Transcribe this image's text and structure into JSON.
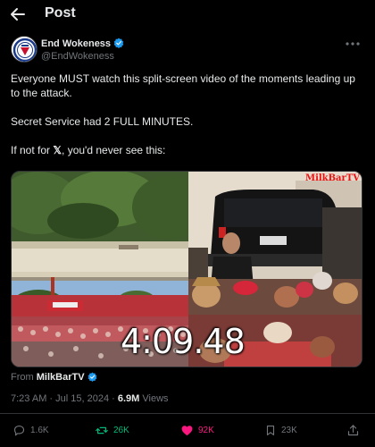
{
  "header": {
    "title": "Post"
  },
  "author": {
    "name": "End Wokeness",
    "handle": "@EndWokeness",
    "avatar_text": "END WOKENESS"
  },
  "tweet": {
    "line1": "Everyone MUST watch this split-screen video of the moments leading up to the attack.",
    "line2": "Secret Service had 2 FULL MINUTES.",
    "line3_pre": "If not for ",
    "line3_x": "𝕏",
    "line3_post": ", you'd never see this:"
  },
  "media": {
    "watermark": "MilkBarTV",
    "timer": "4:09.48"
  },
  "source": {
    "prefix": "From ",
    "name": "MilkBarTV"
  },
  "meta": {
    "time": "7:23 AM",
    "sep1": " · ",
    "date": "Jul 15, 2024",
    "sep2": " · ",
    "views_count": "6.9M",
    "views_label": " Views"
  },
  "actions": {
    "replies": "1.6K",
    "reposts": "26K",
    "likes": "92K",
    "bookmarks": "23K"
  },
  "colors": {
    "background": "#000000",
    "text": "#e7e9ea",
    "muted": "#71767b",
    "verified": "#1d9bf0",
    "repost": "#00ba7c",
    "like": "#f91880",
    "watermark": "#ee1111"
  }
}
